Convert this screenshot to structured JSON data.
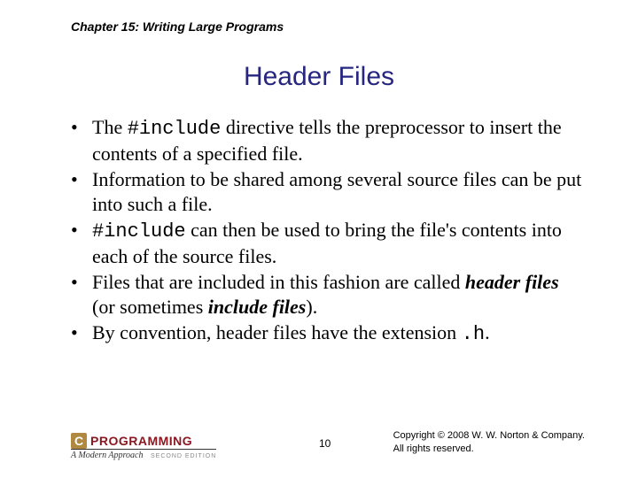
{
  "chapter": "Chapter 15: Writing Large Programs",
  "title": "Header Files",
  "bullets": [
    {
      "parts": [
        {
          "t": "The "
        },
        {
          "t": "#include",
          "cls": "code"
        },
        {
          "t": " directive tells the preprocessor to insert the contents of a specified file."
        }
      ]
    },
    {
      "parts": [
        {
          "t": "Information to be shared among several source files can be put into such a file."
        }
      ]
    },
    {
      "parts": [
        {
          "t": "#include",
          "cls": "code"
        },
        {
          "t": " can then be used to bring the file's contents into each of the source files."
        }
      ]
    },
    {
      "parts": [
        {
          "t": "Files that are included in this fashion are called "
        },
        {
          "t": "header files",
          "cls": "bi"
        },
        {
          "t": " (or sometimes "
        },
        {
          "t": "include files",
          "cls": "bi"
        },
        {
          "t": ")."
        }
      ]
    },
    {
      "parts": [
        {
          "t": "By convention, header files have the extension "
        },
        {
          "t": ".h",
          "cls": "code"
        },
        {
          "t": "."
        }
      ]
    }
  ],
  "logo": {
    "c": "C",
    "word": "PROGRAMMING",
    "sub": "A Modern Approach",
    "edition": "SECOND EDITION"
  },
  "page": "10",
  "copyright": {
    "line1": "Copyright © 2008 W. W. Norton & Company.",
    "line2": "All rights reserved."
  }
}
